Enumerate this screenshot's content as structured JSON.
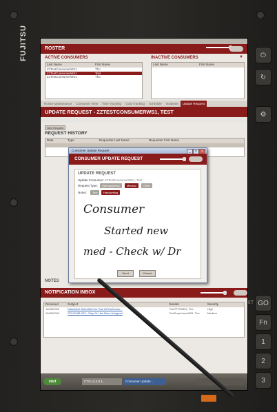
{
  "device": {
    "brand": "FUJITSU"
  },
  "roster": {
    "title": "ROSTER",
    "active_title": "ACTIVE CONSUMERS",
    "inactive_title": "INACTIVE CONSUMERS",
    "active_columns": [
      "Last Name",
      "First Name"
    ],
    "inactive_columns": [
      "Last Name",
      "First Name"
    ],
    "active_rows": [
      {
        "last": "ZzTestConsumerWS1",
        "first": "Tho"
      },
      {
        "last": "ZzTestConsumerWS1",
        "first": "Test"
      },
      {
        "last": "ZzTestConsumerWS1",
        "first": "Tho"
      }
    ]
  },
  "tabs": [
    "Roster Maintenance",
    "Consumer View",
    "Time Tracking",
    "Goal Tracking",
    "Schedule",
    "Incidents",
    "Update Request"
  ],
  "active_tab": "Update Request",
  "update_request": {
    "title": "UPDATE REQUEST - ZZTESTCONSUMERWS1, TEST",
    "history_title": "REQUEST HISTORY",
    "history_columns": [
      "Date",
      "Type",
      "Requestor Last Name",
      "Requestor First Name"
    ],
    "new_request_label": "New Request",
    "notes_label": "NOTES"
  },
  "dialog": {
    "window_title": "Consumer Update Request",
    "header": "CONSUMER UPDATE REQUEST",
    "section_title": "UPDATE REQUEST",
    "consumer_label": "Update Consumer:",
    "consumer_value": "ZzTestConsumerWS1, Test",
    "request_type_label": "Request Type:",
    "request_types": [
      "Demographics",
      "Medical",
      "Other"
    ],
    "notes_label": "Notes:",
    "note_modes": [
      "Text",
      "Handwriting"
    ],
    "handwriting_lines": [
      "Consumer",
      "Started new",
      "med - Check w/ Dr"
    ],
    "send_label": "Send",
    "cancel_label": "Cancel"
  },
  "notifications": {
    "title": "NOTIFICATION INBOX",
    "columns": [
      "Received",
      "Subject",
      "Sender",
      "Severity"
    ],
    "rows": [
      {
        "received": "10/08/2009",
        "subject": "Datasheet Submitted for Test ZzTestConsu...",
        "sender": "TestTTTHMD1, The",
        "severity": "High"
      },
      {
        "received": "10/08/2009",
        "subject": "GR 60168-003 - Step 01 Has Been Assigned",
        "sender": "TestSupervisorWS1, The",
        "severity": "Medium"
      }
    ]
  },
  "taskbar": {
    "start_label": "start",
    "tasks": [
      "CTS-L3.2.8.1...",
      "Consumer Update..."
    ]
  },
  "hw_buttons": [
    "EXIT",
    "GO",
    "Fn",
    "1",
    "2",
    "3"
  ],
  "colors": {
    "accent": "#8a1b1b",
    "screen_bg": "#ece9e4"
  }
}
